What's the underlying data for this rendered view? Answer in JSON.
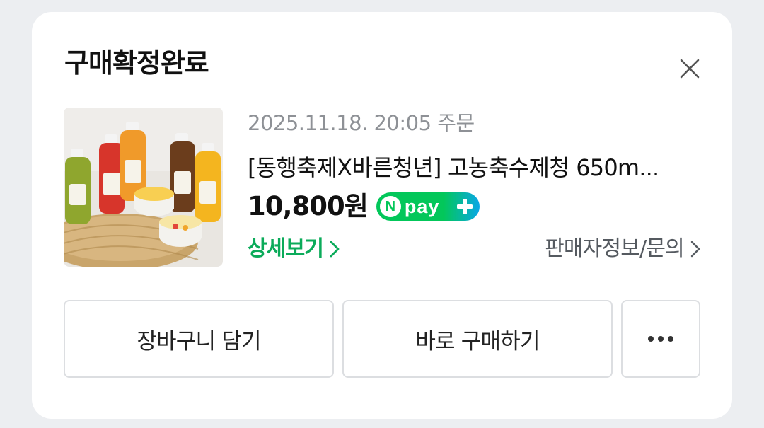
{
  "modal": {
    "title": "구매확정완료"
  },
  "order": {
    "date_label": "2025.11.18. 20:05 주문",
    "product_name": "[동행축제X바른청년] 고농축수제청 650m...",
    "price": "10,800원",
    "npay_badge": {
      "n_letter": "N",
      "text": "pay"
    },
    "detail_link": "상세보기",
    "seller_link": "판매자정보/문의"
  },
  "actions": {
    "cart_label": "장바구니 담기",
    "buy_label": "바로 구매하기"
  },
  "colors": {
    "accent_green": "#0bab5a",
    "npay_green": "#03c75a",
    "npay_blue": "#0aa7e6"
  },
  "icons": [
    "close-icon",
    "chevron-right-icon",
    "plus-icon",
    "more-icon"
  ]
}
